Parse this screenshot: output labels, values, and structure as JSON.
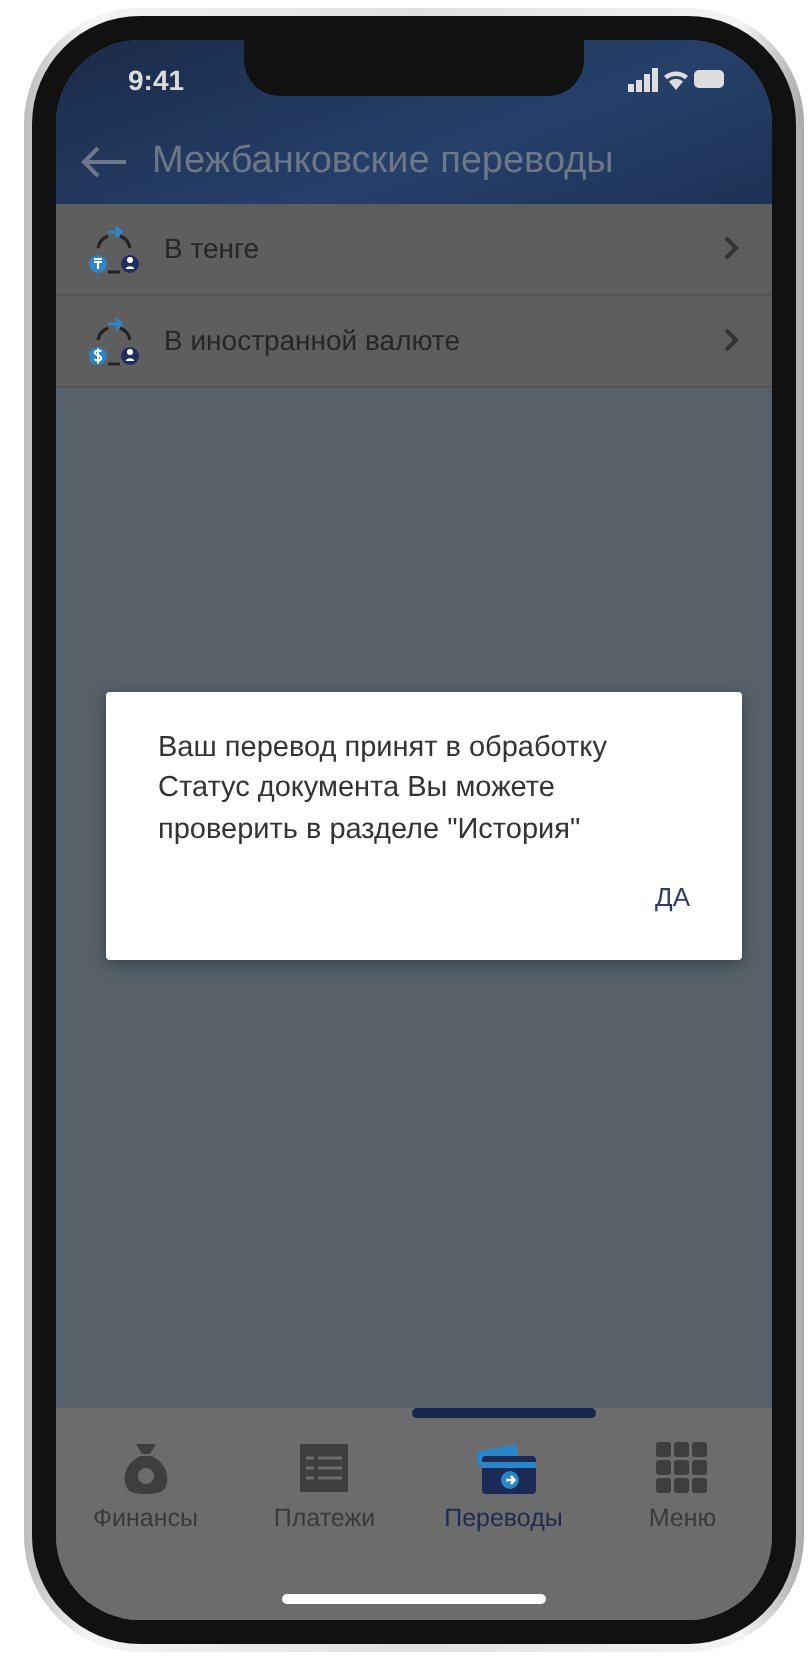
{
  "status_bar": {
    "time": "9:41"
  },
  "header": {
    "title": "Межбанковские переводы"
  },
  "menu_items": [
    {
      "label": "В тенге",
      "kind": "tenge"
    },
    {
      "label": "В иностранной валюте",
      "kind": "foreign"
    }
  ],
  "dialog": {
    "message": "Ваш перевод принят в обработку\nСтатус документа Вы можете\nпроверить в разделе \"История\"",
    "button": "ДА"
  },
  "tabs": [
    {
      "label": "Финансы",
      "kind": "finance",
      "selected": false
    },
    {
      "label": "Платежи",
      "kind": "payments",
      "selected": false
    },
    {
      "label": "Переводы",
      "kind": "transfers",
      "selected": true
    },
    {
      "label": "Меню",
      "kind": "menu",
      "selected": false
    }
  ]
}
